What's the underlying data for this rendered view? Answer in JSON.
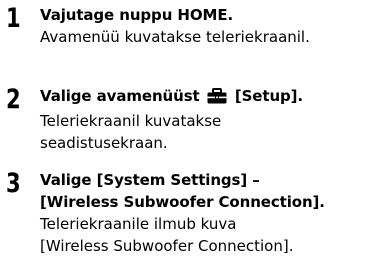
{
  "steps": [
    {
      "number": "1",
      "title": "Vajutage nuppu HOME.",
      "description_lines": [
        "Avamenüü kuvatakse teleriekraanil."
      ]
    },
    {
      "number": "2",
      "title_before_icon": "Valige avamenüüst",
      "icon": "toolbox-icon",
      "title_after_icon": "[Setup].",
      "description_lines": [
        "Teleriekraanil kuvatakse",
        "seadistusekraan."
      ]
    },
    {
      "number": "3",
      "title_lines": [
        "Valige [System Settings] –",
        "[Wireless Subwoofer Connection]."
      ],
      "description_lines": [
        "Teleriekraanile ilmub kuva",
        "[Wireless Subwoofer Connection]."
      ]
    }
  ]
}
